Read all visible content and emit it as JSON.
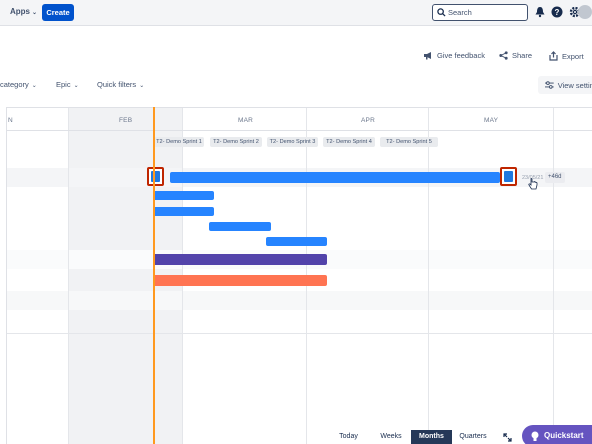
{
  "topnav": {
    "apps_label": "Apps",
    "create_label": "Create",
    "search_placeholder": "Search",
    "icons": [
      "notifications-icon",
      "help-icon",
      "settings-icon",
      "avatar"
    ]
  },
  "header_actions": {
    "feedback_label": "Give feedback",
    "share_label": "Share",
    "export_label": "Export"
  },
  "filters": {
    "category_label": "category",
    "epic_label": "Epic",
    "quick_filters_label": "Quick filters",
    "view_settings_label": "View setting"
  },
  "timeline": {
    "months": [
      "N",
      "FEB",
      "MAR",
      "APR",
      "MAY"
    ],
    "sprints": [
      "T2- Demo Sprint 1",
      "T2- Demo Sprint 2",
      "T2- Demo Sprint 3",
      "T2- Demo Sprint 4",
      "T2- Demo Sprint 5"
    ],
    "end_date": "23/05/21",
    "overflow_badge": "+46d",
    "colors": {
      "blue": "#2684ff",
      "purple": "#5243aa",
      "coral": "#ff7452",
      "today": "#ff991f",
      "highlight": "#bf2600"
    }
  },
  "zoom": {
    "today_label": "Today",
    "weeks_label": "Weeks",
    "months_label": "Months",
    "quarters_label": "Quarters",
    "selected": "Months"
  },
  "quickstart_label": "Quickstart"
}
